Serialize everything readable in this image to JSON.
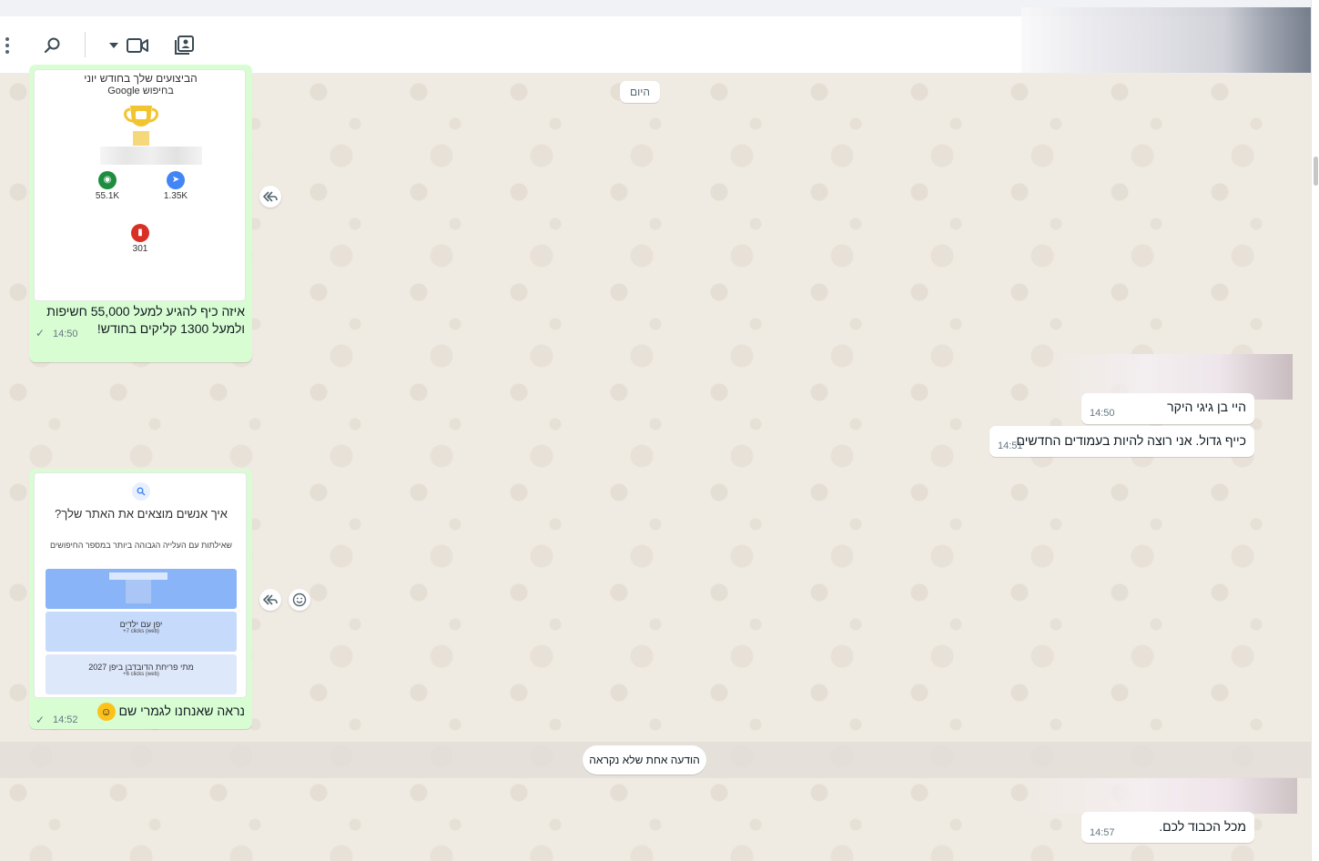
{
  "header": {
    "icons": [
      "menu-icon",
      "search-icon",
      "dropdown-icon",
      "video-icon",
      "contacts-icon"
    ]
  },
  "chat": {
    "day_divider": "היום",
    "unread_divider": "הודעה אחת שלא נקראה"
  },
  "card1": {
    "title_line1": "הביצועים שלך בחודש יוני",
    "title_line2": "בחיפוש Google",
    "stat_impressions": "55.1K",
    "stat_clicks": "1.35K",
    "stat_third": "301"
  },
  "message1": {
    "caption_line1": "איזה כיף להגיע למעל 55,000 חשיפות",
    "caption_line2": "ולמעל 1300 קליקים בחודש!",
    "time": "14:50"
  },
  "incoming1": {
    "text": "היי בן גיגי היקר",
    "time": "14:50"
  },
  "incoming2": {
    "text": "כייף גדול. אני רוצה להיות בעמודים החדשים",
    "time": "14:51"
  },
  "card2": {
    "title": "איך אנשים מוצאים את האתר שלך?",
    "subtitle": "שאילתות עם העלייה הגבוהה ביותר במספר החיפושים",
    "row2_title": "יפן עם ילדים",
    "row2_sub": "+7 clicks (web)",
    "row3_title": "מתי פריחת הדובדבן ביפן 2027",
    "row3_sub": "+6 clicks (web)"
  },
  "message2": {
    "caption": "נראה שאנחנו לגמרי שם",
    "emoji": "☺️",
    "time": "14:52"
  },
  "incoming3": {
    "text": "מכל הכבוד לכם.",
    "time": "14:57"
  },
  "colors": {
    "outgoing_bubble": "#d9fdd3",
    "incoming_bubble": "#ffffff",
    "chat_background": "#efeae2",
    "impressions_icon": "#1e8e3e",
    "clicks_icon": "#4285f4",
    "third_icon": "#d93025",
    "query_highlight": "#8ab4f8",
    "query_row": "#c6dafc"
  }
}
